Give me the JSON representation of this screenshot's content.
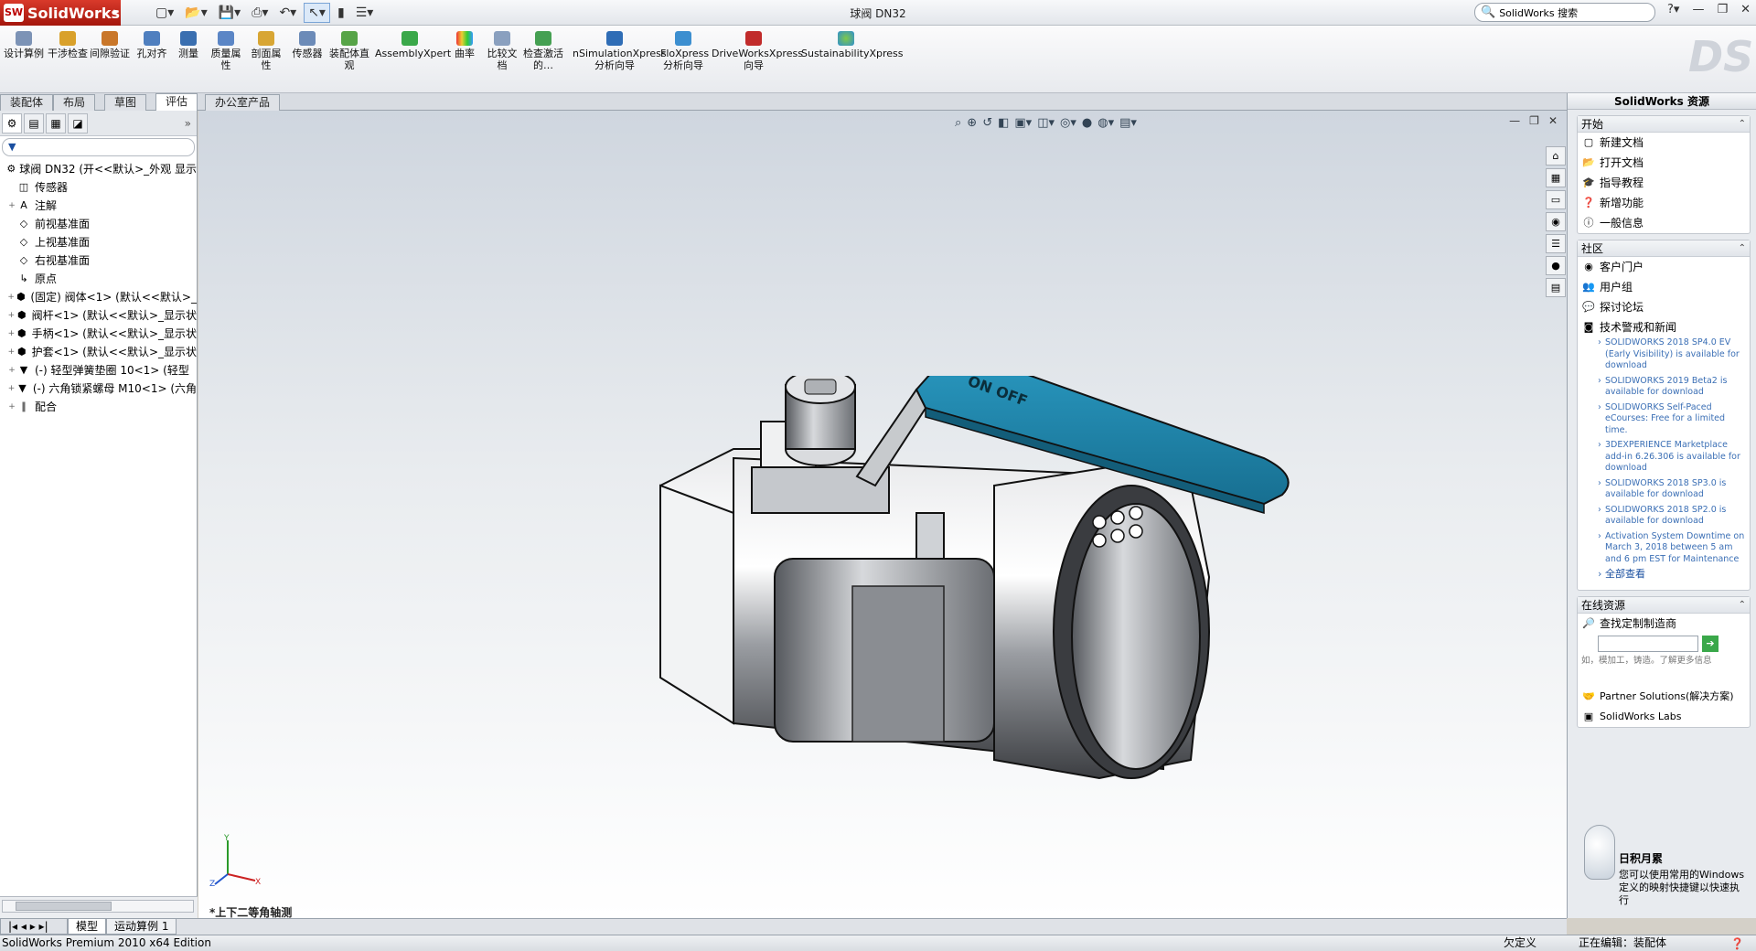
{
  "app": {
    "brand": "SolidWorks",
    "document_title": "球阀 DN32",
    "search_placeholder": "SolidWorks 搜索"
  },
  "ribbon": {
    "buttons": [
      {
        "label": "设计算例",
        "icon": "design-study-icon"
      },
      {
        "label": "干涉检查",
        "icon": "interference-icon"
      },
      {
        "label": "间隙验证",
        "icon": "clearance-icon"
      },
      {
        "label": "孔对齐",
        "icon": "hole-align-icon"
      },
      {
        "label": "测量",
        "icon": "measure-icon"
      },
      {
        "label": "质量属性",
        "icon": "mass-properties-icon"
      },
      {
        "label": "剖面属性",
        "icon": "section-properties-icon"
      },
      {
        "label": "传感器",
        "icon": "sensor-icon"
      },
      {
        "label": "装配体直观",
        "icon": "assembly-visual-icon"
      },
      {
        "label": "AssemblyXpert",
        "icon": "assemblyxpert-icon"
      },
      {
        "label": "曲率",
        "icon": "curvature-icon"
      },
      {
        "label": "比较文档",
        "icon": "compare-icon"
      },
      {
        "label": "检查激活的…",
        "icon": "check-active-icon"
      },
      {
        "label": "nSimulationXpress 分析向导",
        "icon": "simxpress-icon"
      },
      {
        "label": "FloXpress 分析向导",
        "icon": "floxpress-icon"
      },
      {
        "label": "DriveWorksXpress 向导",
        "icon": "driveworks-icon"
      },
      {
        "label": "SustainabilityXpress",
        "icon": "sustainability-icon"
      }
    ]
  },
  "tabs": [
    "装配体",
    "布局",
    "草图",
    "评估",
    "办公室产品"
  ],
  "active_tab": "评估",
  "tree": {
    "filter_label": "▼",
    "items": [
      {
        "label": "球阀 DN32 (开<<默认>_外观 显示",
        "expand": "",
        "icon": "assembly-icon"
      },
      {
        "label": "传感器",
        "expand": "",
        "icon": "sensor-folder-icon"
      },
      {
        "label": "注解",
        "expand": "+",
        "icon": "annotation-icon"
      },
      {
        "label": "前视基准面",
        "expand": "",
        "icon": "plane-icon"
      },
      {
        "label": "上视基准面",
        "expand": "",
        "icon": "plane-icon"
      },
      {
        "label": "右视基准面",
        "expand": "",
        "icon": "plane-icon"
      },
      {
        "label": "原点",
        "expand": "",
        "icon": "origin-icon"
      },
      {
        "label": "(固定) 阀体<1> (默认<<默认>_",
        "expand": "+",
        "icon": "part-icon"
      },
      {
        "label": "阀杆<1> (默认<<默认>_显示状",
        "expand": "+",
        "icon": "part-icon"
      },
      {
        "label": "手柄<1> (默认<<默认>_显示状",
        "expand": "+",
        "icon": "part-icon"
      },
      {
        "label": "护套<1> (默认<<默认>_显示状",
        "expand": "+",
        "icon": "part-icon"
      },
      {
        "label": "(-) 轻型弹簧垫圈 10<1> (轻型",
        "expand": "+",
        "icon": "toolbox-part-icon"
      },
      {
        "label": "(-) 六角锁紧螺母 M10<1> (六角",
        "expand": "+",
        "icon": "toolbox-part-icon"
      },
      {
        "label": "配合",
        "expand": "+",
        "icon": "mates-icon"
      }
    ]
  },
  "viewport": {
    "view_name": "*上下二等角轴测",
    "handle_text": "ON OFF"
  },
  "sheet_tabs": [
    "模型",
    "运动算例 1"
  ],
  "task_pane": {
    "title": "SolidWorks 资源",
    "start": {
      "header": "开始",
      "items": [
        "新建文档",
        "打开文档",
        "指导教程",
        "新增功能",
        "一般信息"
      ]
    },
    "community": {
      "header": "社区",
      "items": [
        "客户门户",
        "用户组",
        "探讨论坛",
        "技术警戒和新闻"
      ],
      "news": [
        "SOLIDWORKS 2018 SP4.0 EV (Early Visibility) is available for download",
        "SOLIDWORKS 2019 Beta2 is available for download",
        "SOLIDWORKS Self-Paced eCourses: Free for a limited time.",
        "3DEXPERIENCE Marketplace add-in 6.26.306 is available for download",
        "SOLIDWORKS 2018 SP3.0 is available for download",
        "SOLIDWORKS 2018 SP2.0 is available for download",
        "Activation System Downtime on March 3, 2018 between 5 am and 6 pm EST for Maintenance"
      ],
      "view_all": "全部查看"
    },
    "online": {
      "header": "在线资源",
      "find_label": "查找定制制造商",
      "hint": "如，模加工，铸造。了解更多信息",
      "partner": "Partner Solutions(解决方案)",
      "labs": "SolidWorks Labs"
    },
    "tip": {
      "title": "日积月累",
      "text": "您可以使用常用的Windows定义的映射快捷键以快速执行"
    }
  },
  "status": {
    "left": "SolidWorks Premium 2010 x64 Edition",
    "undefined": "欠定义",
    "editing": "正在编辑：装配体"
  },
  "colors": {
    "handle_blue": "#1f84a8",
    "brand_red": "#c0271b",
    "viewport_top": "#cfd6df"
  }
}
